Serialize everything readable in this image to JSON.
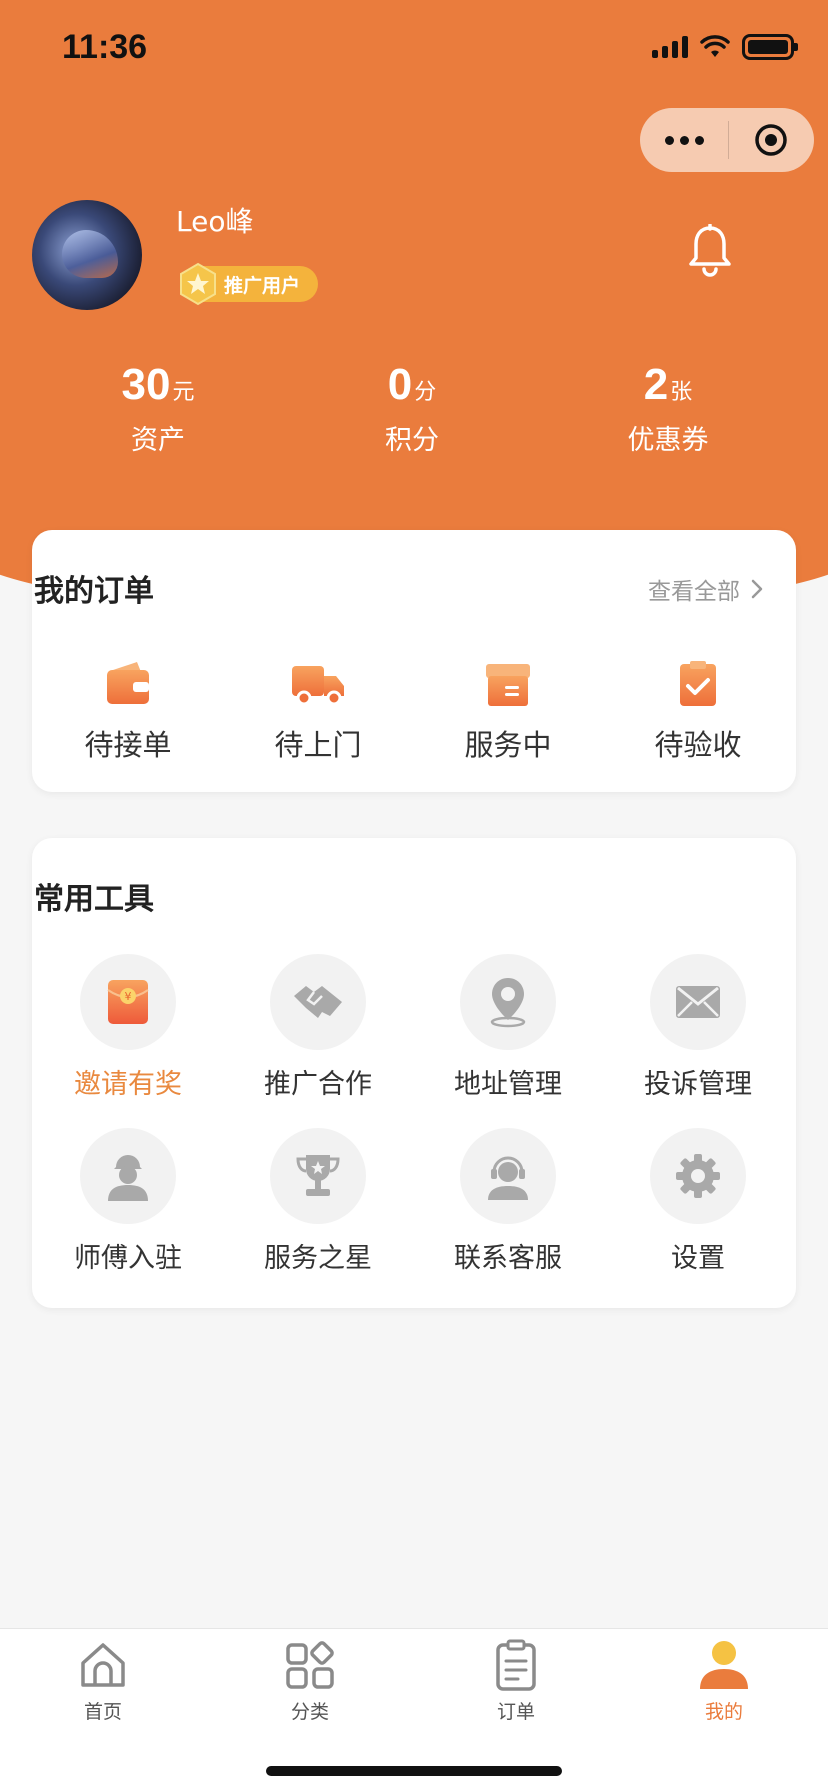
{
  "status_bar": {
    "time": "11:36"
  },
  "profile": {
    "username": "Leo峰",
    "badge": "推广用户"
  },
  "stats": [
    {
      "value": "30",
      "unit": "元",
      "label": "资产"
    },
    {
      "value": "0",
      "unit": "分",
      "label": "积分"
    },
    {
      "value": "2",
      "unit": "张",
      "label": "优惠券"
    }
  ],
  "orders": {
    "title": "我的订单",
    "view_all": "查看全部",
    "items": [
      {
        "label": "待接单",
        "icon": "wallet-icon"
      },
      {
        "label": "待上门",
        "icon": "truck-icon"
      },
      {
        "label": "服务中",
        "icon": "box-icon"
      },
      {
        "label": "待验收",
        "icon": "clipboard-check-icon"
      }
    ]
  },
  "tools": {
    "title": "常用工具",
    "items": [
      {
        "label": "邀请有奖",
        "icon": "red-envelope-icon"
      },
      {
        "label": "推广合作",
        "icon": "handshake-icon"
      },
      {
        "label": "地址管理",
        "icon": "location-pin-icon"
      },
      {
        "label": "投诉管理",
        "icon": "envelope-icon"
      },
      {
        "label": "师傅入驻",
        "icon": "worker-icon"
      },
      {
        "label": "服务之星",
        "icon": "trophy-icon"
      },
      {
        "label": "联系客服",
        "icon": "headset-icon"
      },
      {
        "label": "设置",
        "icon": "gear-icon"
      }
    ]
  },
  "tabbar": {
    "items": [
      {
        "label": "首页",
        "icon": "home-icon"
      },
      {
        "label": "分类",
        "icon": "category-icon"
      },
      {
        "label": "订单",
        "icon": "order-icon"
      },
      {
        "label": "我的",
        "icon": "profile-icon",
        "active": true
      }
    ]
  },
  "colors": {
    "brand": "#ea7c3d",
    "badge": "#f4b33c",
    "accent_text": "#e9893f"
  }
}
